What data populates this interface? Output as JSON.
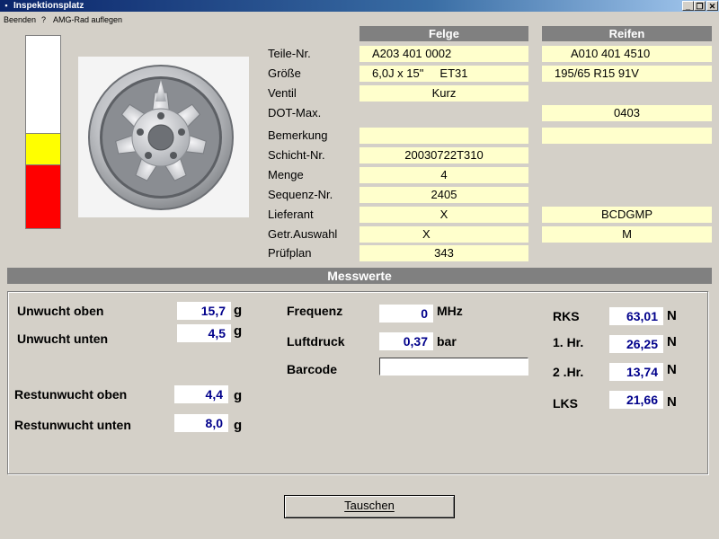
{
  "window": {
    "title": "Inspektionsplatz",
    "minimize": "_",
    "restore": "❐",
    "close": "✕",
    "icon": "app-icon"
  },
  "menu": {
    "items": [
      "Beenden",
      "?",
      "AMG-Rad auflegen"
    ]
  },
  "indicator": {
    "colors": {
      "white": "#ffffff",
      "yellow": "#ffff00",
      "red": "#ff0000"
    }
  },
  "headers": {
    "felge": "Felge",
    "reifen": "Reifen"
  },
  "rows": [
    {
      "label": "Teile-Nr.",
      "felge": "A203 401 0002",
      "reifen": "A010 401 4510"
    },
    {
      "label": "Größe",
      "felge": "6,0J x 15\"     ET31",
      "reifen": "195/65 R15 91V"
    },
    {
      "label": "Ventil",
      "felge": "Kurz",
      "reifen": null
    },
    {
      "label": "DOT-Max.",
      "felge": null,
      "reifen": "0403"
    },
    {
      "label": "Bemerkung",
      "felge": "",
      "reifen": ""
    },
    {
      "label": "Schicht-Nr.",
      "felge": "20030722T310",
      "reifen": null
    },
    {
      "label": "Menge",
      "felge": "4",
      "reifen": null
    },
    {
      "label": "Sequenz-Nr.",
      "felge": "2405",
      "reifen": null
    },
    {
      "label": "Lieferant",
      "felge": "X",
      "reifen": "BCDGMP"
    },
    {
      "label": "Getr.Auswahl",
      "felge": "X",
      "reifen": "M"
    },
    {
      "label": "Prüfplan",
      "felge": "343",
      "reifen": null
    }
  ],
  "messwerte": {
    "title": "Messwerte",
    "unwucht_oben": {
      "label": "Unwucht oben",
      "value": "15,7",
      "unit": "g"
    },
    "unwucht_unten": {
      "label": "Unwucht unten",
      "value": "4,5",
      "unit": "g"
    },
    "restunwucht_oben": {
      "label": "Restunwucht oben",
      "value": "4,4",
      "unit": "g"
    },
    "restunwucht_unten": {
      "label": "Restunwucht unten",
      "value": "8,0",
      "unit": "g"
    },
    "frequenz": {
      "label": "Frequenz",
      "value": "0",
      "unit": "MHz"
    },
    "luftdruck": {
      "label": "Luftdruck",
      "value": "0,37",
      "unit": "bar"
    },
    "barcode": {
      "label": "Barcode",
      "value": ""
    },
    "rks": {
      "label": "RKS",
      "value": "63,01",
      "unit": "N"
    },
    "hr1": {
      "label": "1. Hr.",
      "value": "26,25",
      "unit": "N"
    },
    "hr2": {
      "label": "2 .Hr.",
      "value": "13,74",
      "unit": "N"
    },
    "lks": {
      "label": "LKS",
      "value": "21,66",
      "unit": "N"
    }
  },
  "buttons": {
    "tauschen": "Tauschen"
  }
}
